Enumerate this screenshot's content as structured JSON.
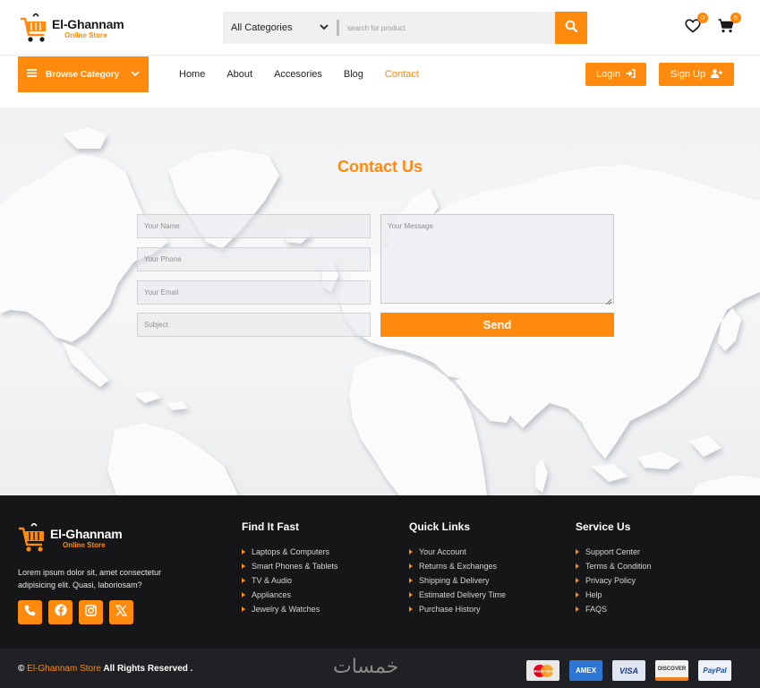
{
  "brand": {
    "name": "El-Ghannam",
    "tagline": "Online Store"
  },
  "search": {
    "category": "All Categories",
    "placeholder": "search for product"
  },
  "header": {
    "wishlist_count": "0",
    "cart_count": "5"
  },
  "nav": {
    "browse_label": "Browse Category",
    "links": [
      "Home",
      "About",
      "Accesories",
      "Blog",
      "Contact"
    ],
    "active": "Contact",
    "login_label": "Login",
    "signup_label": "Sign Up"
  },
  "contact": {
    "title": "Contact Us",
    "name_placeholder": "Your Name",
    "phone_placeholder": "Your Phone",
    "email_placeholder": "Your Email",
    "subject_placeholder": "Subject",
    "message_placeholder": "Your Message",
    "send_label": "Send"
  },
  "footer": {
    "description": "Lorem ipsum dolor sit, amet consectetur adipisicing elit. Quasi, laboriosam?",
    "socials": [
      "phone-icon",
      "facebook-icon",
      "instagram-icon",
      "x-icon"
    ],
    "columns": [
      {
        "title": "Find It Fast",
        "items": [
          "Laptops & Computers",
          "Smart Phones & Tablets",
          "TV & Audio",
          "Appliances",
          "Jewelry & Watches"
        ]
      },
      {
        "title": "Quick Links",
        "items": [
          "Your Account",
          "Returns & Exchanges",
          "Shipping & Delivery",
          "Estimated Delivery Time",
          "Purchase History"
        ]
      },
      {
        "title": "Service Us",
        "items": [
          "Support Center",
          "Terms & Condition",
          "Privacy Policy",
          "Help",
          "FAQS"
        ]
      }
    ]
  },
  "bottom": {
    "copyright_symbol": "©",
    "copyright_brand": "El-Ghannam Store",
    "copyright_text": "All Rights Reserved .",
    "watermark": "خمسات",
    "payments": [
      "MasterCard",
      "AMEX",
      "VISA",
      "DISCOVER",
      "PayPal"
    ]
  },
  "colors": {
    "accent": "#ff8a0d",
    "footer_bg": "#151618",
    "bottom_bg": "#202124"
  }
}
